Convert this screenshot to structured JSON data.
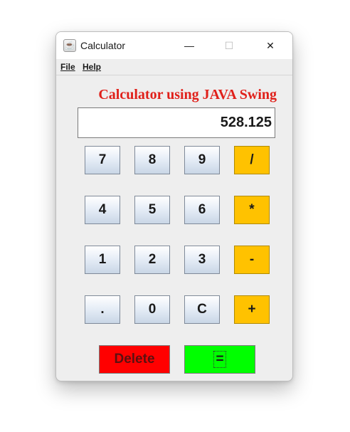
{
  "window": {
    "title": "Calculator",
    "icon": "java-coffee-cup-icon",
    "controls": {
      "minimize": "—",
      "maximize": "☐",
      "close": "✕"
    }
  },
  "menubar": {
    "file": "File",
    "help": "Help"
  },
  "heading": "Calculator using JAVA Swing",
  "display": {
    "value": "528.125"
  },
  "keys": {
    "k7": "7",
    "k8": "8",
    "k9": "9",
    "div": "/",
    "k4": "4",
    "k5": "5",
    "k6": "6",
    "mul": "*",
    "k1": "1",
    "k2": "2",
    "k3": "3",
    "sub": "-",
    "dot": ".",
    "k0": "0",
    "clear": "C",
    "add": "+"
  },
  "actions": {
    "delete": "Delete",
    "equals": "="
  },
  "colors": {
    "heading": "#e0201a",
    "operator": "#ffc200",
    "delete": "#ff0000",
    "equals": "#00ff00"
  }
}
